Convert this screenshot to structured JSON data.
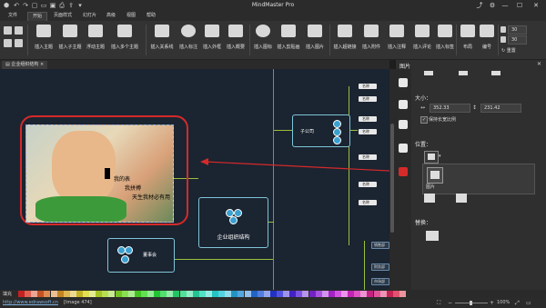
{
  "window": {
    "title": "MindMaster Pro",
    "min": "—",
    "max": "☐",
    "close": "✕"
  },
  "menu": [
    {
      "label": "文件"
    },
    {
      "label": "开始"
    },
    {
      "label": "页面样式"
    },
    {
      "label": "幻灯片"
    },
    {
      "label": "高级"
    },
    {
      "label": "视图"
    },
    {
      "label": "帮助"
    }
  ],
  "ribbon": {
    "buttons": [
      {
        "label": "插入主题"
      },
      {
        "label": "插入子主题"
      },
      {
        "label": "浮动主题"
      },
      {
        "label": "插入多个主题"
      },
      {
        "label": "插入关系线"
      },
      {
        "label": "插入标注"
      },
      {
        "label": "插入外框"
      },
      {
        "label": "插入概要"
      },
      {
        "label": "插入图标"
      },
      {
        "label": "插入剪贴画"
      },
      {
        "label": "插入图片"
      },
      {
        "label": "插入超链接"
      },
      {
        "label": "插入附件"
      },
      {
        "label": "插入注释"
      },
      {
        "label": "插入评论"
      },
      {
        "label": "插入标签"
      },
      {
        "label": "布局"
      },
      {
        "label": "编号"
      }
    ],
    "spin1": "30",
    "spin2": "30",
    "reset": "重置"
  },
  "doc_tab": {
    "label": "企业组织结构"
  },
  "canvas": {
    "photo_text": [
      "我的表",
      "我拼搏",
      "天生我材必有用"
    ],
    "center_node": "企业组织结构",
    "branch_sub": "子公司",
    "branch_board": "董事会",
    "right_nodes": [
      "名称",
      "名称",
      "名称",
      "名称",
      "名称",
      "名称",
      "名称"
    ],
    "bottom_right_nodes": [
      "销售部",
      "财务部",
      "市场部"
    ]
  },
  "panel": {
    "header": "图片",
    "size_label": "大小：",
    "width": "352.33",
    "height": "231.42",
    "keep_ratio": "保持长宽比例",
    "position_label": "位置：",
    "popup_label": "图片",
    "replace_label": "替换："
  },
  "status": {
    "fill_label": "填充",
    "url": "http://www.edrawsoft.cn",
    "image_label": "[Image 474]",
    "zoom": "100%"
  },
  "colors": {
    "accent_red": "#d42a2a",
    "node_border": "#7fc6d8",
    "branch_line": "#9abf3a",
    "canvas_bg": "#1b2431"
  }
}
